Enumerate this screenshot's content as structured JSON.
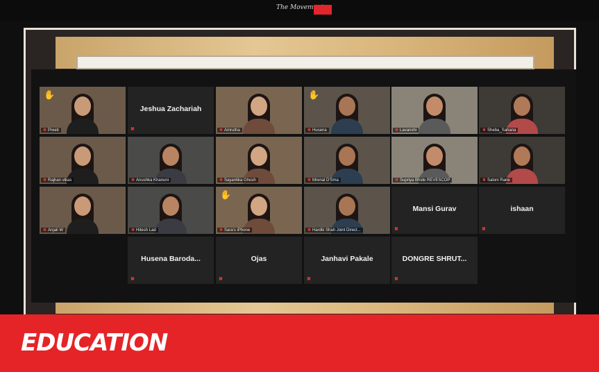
{
  "header": {
    "logo_script": "The Movement",
    "logo_icon": "brand-logo"
  },
  "footer": {
    "label": "EDUCATION"
  },
  "colors": {
    "accent": "#e52428",
    "tile_bg": "#232323",
    "mic_muted": "#e53935"
  },
  "participants": [
    {
      "name": "Preeti",
      "video": true,
      "raised_hand": true
    },
    {
      "name": "Jeshua Zachariah",
      "video": false,
      "raised_hand": false
    },
    {
      "name": "Amrutha",
      "video": true,
      "raised_hand": false
    },
    {
      "name": "Husena",
      "video": true,
      "raised_hand": true
    },
    {
      "name": "Lavanshi",
      "video": true,
      "raised_hand": false
    },
    {
      "name": "Sheba_Sahana",
      "video": true,
      "raised_hand": false
    },
    {
      "name": "Rajhan vikas",
      "video": true,
      "raised_hand": false
    },
    {
      "name": "Anushka Khanuni",
      "video": true,
      "raised_hand": false
    },
    {
      "name": "Sayantika Ghosh",
      "video": true,
      "raised_hand": false
    },
    {
      "name": "Mrenal D'Sma",
      "video": true,
      "raised_hand": false
    },
    {
      "name": "Supriya Bhide REVESCOP",
      "video": true,
      "raised_hand": false
    },
    {
      "name": "Saloni Rane",
      "video": true,
      "raised_hand": false
    },
    {
      "name": "Anjali W",
      "video": true,
      "raised_hand": false
    },
    {
      "name": "Hitesh Lad",
      "video": true,
      "raised_hand": false
    },
    {
      "name": "Sara's iPhone",
      "video": true,
      "raised_hand": true
    },
    {
      "name": "Hardik Shah Joint Direct...",
      "video": true,
      "raised_hand": false
    },
    {
      "name": "Mansi Gurav",
      "video": false,
      "raised_hand": false
    },
    {
      "name": "ishaan",
      "video": false,
      "raised_hand": false
    },
    {
      "name": "Husena Baroda...",
      "video": false,
      "raised_hand": false
    },
    {
      "name": "Ojas",
      "video": false,
      "raised_hand": false
    },
    {
      "name": "Janhavi Pakale",
      "video": false,
      "raised_hand": false
    },
    {
      "name": "DONGRE SHRUT...",
      "video": false,
      "raised_hand": false
    }
  ]
}
